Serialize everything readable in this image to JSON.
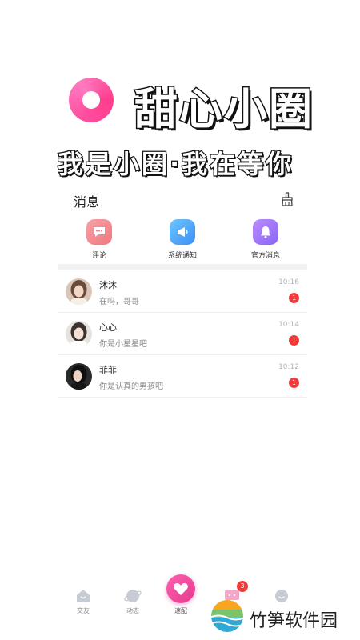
{
  "promo": {
    "app_title": "甜心小圈",
    "slogan": "我是小圈·我在等你"
  },
  "page": {
    "title": "消息"
  },
  "categories": [
    {
      "label": "评论",
      "icon": "comment-icon",
      "color": "#f0787e"
    },
    {
      "label": "系统通知",
      "icon": "megaphone-icon",
      "color": "#3d8ff5"
    },
    {
      "label": "官方消息",
      "icon": "bell-icon",
      "color": "#8b65f5"
    }
  ],
  "conversations": [
    {
      "name": "沐沐",
      "preview": "在吗，哥哥",
      "time": "10:16",
      "unread": "1"
    },
    {
      "name": "心心",
      "preview": "你是小星星吧",
      "time": "10:14",
      "unread": "1"
    },
    {
      "name": "菲菲",
      "preview": "你是认真的男孩吧",
      "time": "10:12",
      "unread": "1"
    }
  ],
  "tabbar": {
    "items": [
      {
        "label": "交友",
        "icon": "home-icon"
      },
      {
        "label": "动态",
        "icon": "planet-icon"
      },
      {
        "label": "速配",
        "icon": "heart-icon"
      },
      {
        "label": "",
        "icon": "message-icon",
        "badge": "3"
      },
      {
        "label": "",
        "icon": "profile-icon"
      }
    ]
  },
  "watermark": {
    "text": "竹笋软件园"
  },
  "colors": {
    "accent_pink": "#ff4fa0",
    "badge_red": "#f23a3a"
  }
}
